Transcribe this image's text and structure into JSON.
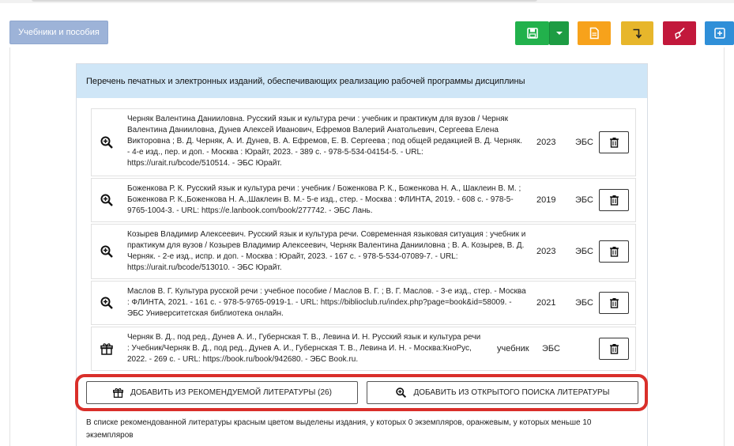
{
  "tab": {
    "label": "Учебники и пособия"
  },
  "toolbar": {
    "save_icon": "save-icon",
    "dropdown_icon": "caret-down-icon",
    "doc_icon": "document-icon",
    "arrow_icon": "turn-down-arrow-icon",
    "clear_icon": "broom-icon",
    "export_icon": "box-arrow-icon",
    "colors": {
      "green": "#22b14c",
      "orange": "#f7a21b",
      "yellow": "#e7b62b",
      "red": "#c2183b",
      "blue": "#2f8fd8"
    }
  },
  "panel": {
    "title": "Перечень печатных и электронных изданий, обеспечивающих реализацию рабочей программы дисциплины",
    "rows": [
      {
        "icon": "search-plus-icon",
        "text": "Черняк Валентина Данииловна. Русский язык и культура речи : учебник и практикум для вузов / Черняк Валентина Данииловна, Дунев Алексей Иванович, Ефремов Валерий Анатольевич, Сергеева Елена Викторовна ; В. Д. Черняк, А. И. Дунев, В. А. Ефремов, Е. В. Сергеева ; под общей редакцией В. Д. Черняк. - 4-е изд., пер. и доп. - Москва : Юрайт, 2023. - 389 с. - 978-5-534-04154-5. - URL: https://urait.ru/bcode/510514. - ЭБС Юрайт.",
        "year": "2023",
        "source": "ЭБС"
      },
      {
        "icon": "search-plus-icon",
        "text": "Боженкова Р. К. Русский язык и культура речи : учебник / Боженкова Р. К., Боженкова Н. А., Шаклеин В. М. ; Боженкова Р. К.,Боженкова Н. А.,Шаклеин В. М.- 5-е изд., стер. - Москва : ФЛИНТА, 2019. - 608 с. - 978-5-9765-1004-3. - URL: https://e.lanbook.com/book/277742. - ЭБС Лань.",
        "year": "2019",
        "source": "ЭБС"
      },
      {
        "icon": "search-plus-icon",
        "text": "Козырев Владимир Алексеевич. Русский язык и культура речи. Современная языковая ситуация : учебник и практикум для вузов / Козырев Владимир Алексеевич, Черняк Валентина Данииловна ; В. А. Козырев, В. Д. Черняк. - 2-е изд., испр. и доп. - Москва : Юрайт, 2023. - 167 с. - 978-5-534-07089-7. - URL: https://urait.ru/bcode/513010. - ЭБС Юрайт.",
        "year": "2023",
        "source": "ЭБС"
      },
      {
        "icon": "search-plus-icon",
        "text": "Маслов В. Г. Культура русской речи : учебное пособие / Маслов В. Г. ; В. Г. Маслов. - 3-е изд., стер. - Москва : ФЛИНТА, 2021. - 161 с. - 978-5-9765-0919-1. - URL: https://biblioclub.ru/index.php?page=book&id=58009. - ЭБС Университетская библиотека онлайн.",
        "year": "2021",
        "source": "ЭБС"
      },
      {
        "icon": "gift-icon",
        "text": "Черняк В. Д., под ред., Дунев А. И., Губернская Т. В., Левина И. Н. Русский язык и культура речи : Учебник/Черняк В. Д., под ред., Дунев А. И., Губернская Т. В., Левина И. Н. - Москва:КноРус, 2022. - 269 с. - URL: https://book.ru/book/942680. - ЭБС Book.ru.",
        "type": "учебник",
        "source": "ЭБС"
      }
    ],
    "add_recommended": "ДОБАВИТЬ ИЗ РЕКОМЕНДУЕМОЙ ЛИТЕРАТУРЫ (26)",
    "add_open_search": "ДОБАВИТЬ ИЗ ОТКРЫТОГО ПОИСКА ЛИТЕРАТУРЫ",
    "note": "В списке рекомендованной литературы красным цветом выделены издания, у которых 0 экземпляров, оранжевым, у которых меньше 10 экземпляров"
  }
}
